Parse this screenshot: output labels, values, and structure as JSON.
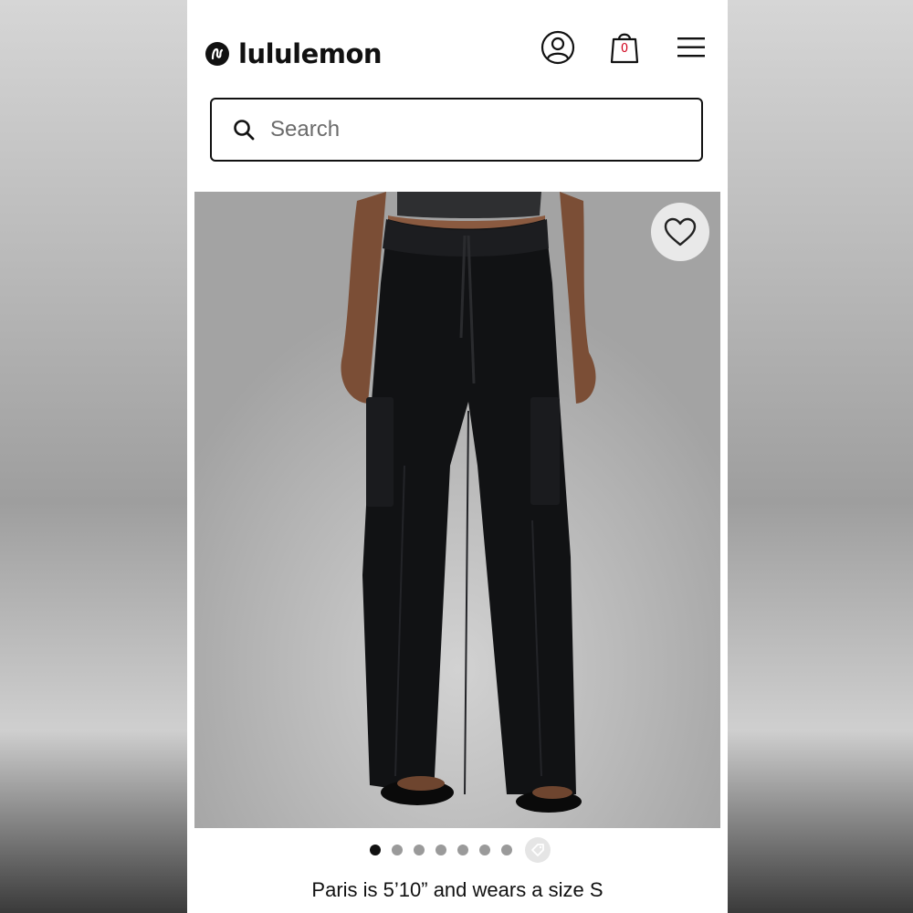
{
  "brand": {
    "name": "lululemon"
  },
  "header": {
    "account_icon": "account-icon",
    "bag_icon": "shopping-bag-icon",
    "bag_count": "0",
    "menu_icon": "hamburger-menu-icon"
  },
  "search": {
    "placeholder": "Search",
    "value": ""
  },
  "product": {
    "image": "product-photo-black-cargo-pants",
    "favorite_icon": "heart-icon"
  },
  "carousel": {
    "total_dots": 7,
    "active_index": 0,
    "extra_icon": "tag-icon"
  },
  "caption": "Paris is 5’10” and wears a size S"
}
